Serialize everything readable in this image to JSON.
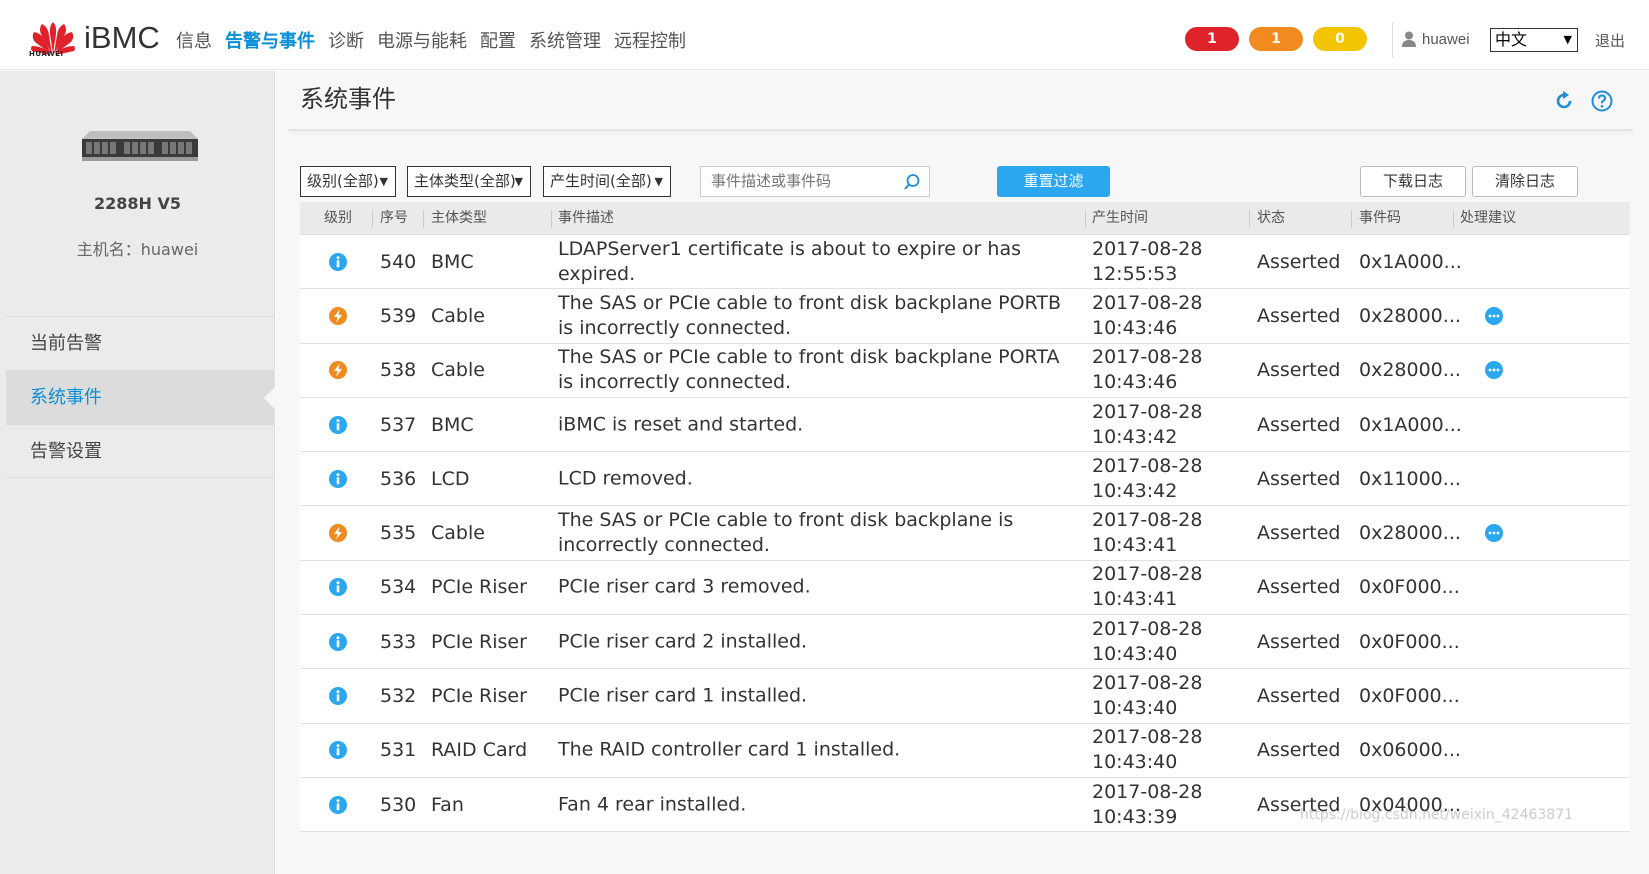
{
  "header": {
    "logo_text": "HUAWEI",
    "brand": "iBMC",
    "nav": [
      {
        "label": "信息",
        "active": false
      },
      {
        "label": "告警与事件",
        "active": true
      },
      {
        "label": "诊断",
        "active": false
      },
      {
        "label": "电源与能耗",
        "active": false
      },
      {
        "label": "配置",
        "active": false
      },
      {
        "label": "系统管理",
        "active": false
      },
      {
        "label": "远程控制",
        "active": false
      }
    ],
    "badges": {
      "critical": "1",
      "major": "1",
      "minor": "0"
    },
    "username": "huawei",
    "language": "中文",
    "logout": "退出",
    "colors": {
      "accent": "#0a8ed8",
      "critical": "#e0232b",
      "major": "#f28b1f",
      "minor": "#f2c500"
    }
  },
  "sidebar": {
    "model": "2288H V5",
    "hostname": "主机名：huawei",
    "menu": [
      {
        "label": "当前告警",
        "active": false
      },
      {
        "label": "系统事件",
        "active": true
      },
      {
        "label": "告警设置",
        "active": false
      }
    ]
  },
  "main": {
    "title": "系统事件",
    "filters": {
      "level": "级别(全部)",
      "subject_type": "主体类型(全部)",
      "time": "产生时间(全部)",
      "search_placeholder": "事件描述或事件码",
      "reset_label": "重置过滤",
      "download_label": "下载日志",
      "clear_label": "清除日志"
    },
    "columns": [
      "级别",
      "序号",
      "主体类型",
      "事件描述",
      "产生时间",
      "状态",
      "事件码",
      "处理建议"
    ],
    "rows": [
      {
        "level": "info",
        "id": "540",
        "type": "BMC",
        "desc": "LDAPServer1 certificate is about to expire or has expired.",
        "date": "2017-08-28",
        "time": "12:55:53",
        "status": "Asserted",
        "code": "0x1A000...",
        "suggest": false
      },
      {
        "level": "major",
        "id": "539",
        "type": "Cable",
        "desc": "The SAS or PCIe cable to front disk backplane PORTB is incorrectly connected.",
        "date": "2017-08-28",
        "time": "10:43:46",
        "status": "Asserted",
        "code": "0x28000...",
        "suggest": true
      },
      {
        "level": "major",
        "id": "538",
        "type": "Cable",
        "desc": "The SAS or PCIe cable to front disk backplane PORTA is incorrectly connected.",
        "date": "2017-08-28",
        "time": "10:43:46",
        "status": "Asserted",
        "code": "0x28000...",
        "suggest": true
      },
      {
        "level": "info",
        "id": "537",
        "type": "BMC",
        "desc": "iBMC is reset and started.",
        "date": "2017-08-28",
        "time": "10:43:42",
        "status": "Asserted",
        "code": "0x1A000...",
        "suggest": false
      },
      {
        "level": "info",
        "id": "536",
        "type": "LCD",
        "desc": "LCD removed.",
        "date": "2017-08-28",
        "time": "10:43:42",
        "status": "Asserted",
        "code": "0x11000...",
        "suggest": false
      },
      {
        "level": "major",
        "id": "535",
        "type": "Cable",
        "desc": "The SAS or PCIe cable to front disk backplane is incorrectly connected.",
        "date": "2017-08-28",
        "time": "10:43:41",
        "status": "Asserted",
        "code": "0x28000...",
        "suggest": true
      },
      {
        "level": "info",
        "id": "534",
        "type": "PCIe Riser",
        "desc": "PCIe riser card 3 removed.",
        "date": "2017-08-28",
        "time": "10:43:41",
        "status": "Asserted",
        "code": "0x0F000...",
        "suggest": false
      },
      {
        "level": "info",
        "id": "533",
        "type": "PCIe Riser",
        "desc": "PCIe riser card 2 installed.",
        "date": "2017-08-28",
        "time": "10:43:40",
        "status": "Asserted",
        "code": "0x0F000...",
        "suggest": false
      },
      {
        "level": "info",
        "id": "532",
        "type": "PCIe Riser",
        "desc": "PCIe riser card 1 installed.",
        "date": "2017-08-28",
        "time": "10:43:40",
        "status": "Asserted",
        "code": "0x0F000...",
        "suggest": false
      },
      {
        "level": "info",
        "id": "531",
        "type": "RAID Card",
        "desc": "The RAID controller card 1 installed.",
        "date": "2017-08-28",
        "time": "10:43:40",
        "status": "Asserted",
        "code": "0x06000...",
        "suggest": false
      },
      {
        "level": "info",
        "id": "530",
        "type": "Fan",
        "desc": "Fan 4 rear installed.",
        "date": "2017-08-28",
        "time": "10:43:39",
        "status": "Asserted",
        "code": "0x04000...",
        "suggest": false
      }
    ]
  },
  "watermark": "https://blog.csdn.net/weixin_42463871"
}
